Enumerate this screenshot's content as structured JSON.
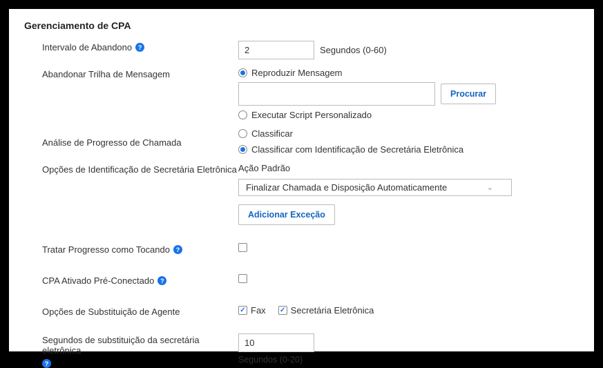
{
  "section_title": "Gerenciamento de CPA",
  "abandon_interval": {
    "label": "Intervalo de Abandono",
    "value": "2",
    "unit": "Segundos (0-60)"
  },
  "abandon_trail": {
    "label": "Abandonar Trilha de Mensagem",
    "option_reproduce": "Reproduzir Mensagem",
    "option_script": "Executar Script Personalizado",
    "browse_button": "Procurar",
    "file_value": ""
  },
  "call_progress": {
    "label": "Análise de Progresso de Chamada",
    "option_classify": "Classificar",
    "option_classify_am": "Classificar com Identificação de Secretária Eletrônica"
  },
  "am_options": {
    "label": "Opções de Identificação de Secretária Eletrônica",
    "action_label": "Ação Padrão",
    "action_selected": "Finalizar Chamada e Disposição Automaticamente",
    "add_exception": "Adicionar Exceção"
  },
  "treat_progress": {
    "label": "Tratar Progresso como Tocando"
  },
  "cpa_preconnect": {
    "label": "CPA Ativado Pré-Conectado"
  },
  "agent_override": {
    "label": "Opções de Substituição de Agente",
    "fax": "Fax",
    "am": "Secretária Eletrônica"
  },
  "override_seconds": {
    "label": "Segundos de substituição da secretária eletrônica",
    "value": "10",
    "unit": "Segundos (0-20)"
  }
}
